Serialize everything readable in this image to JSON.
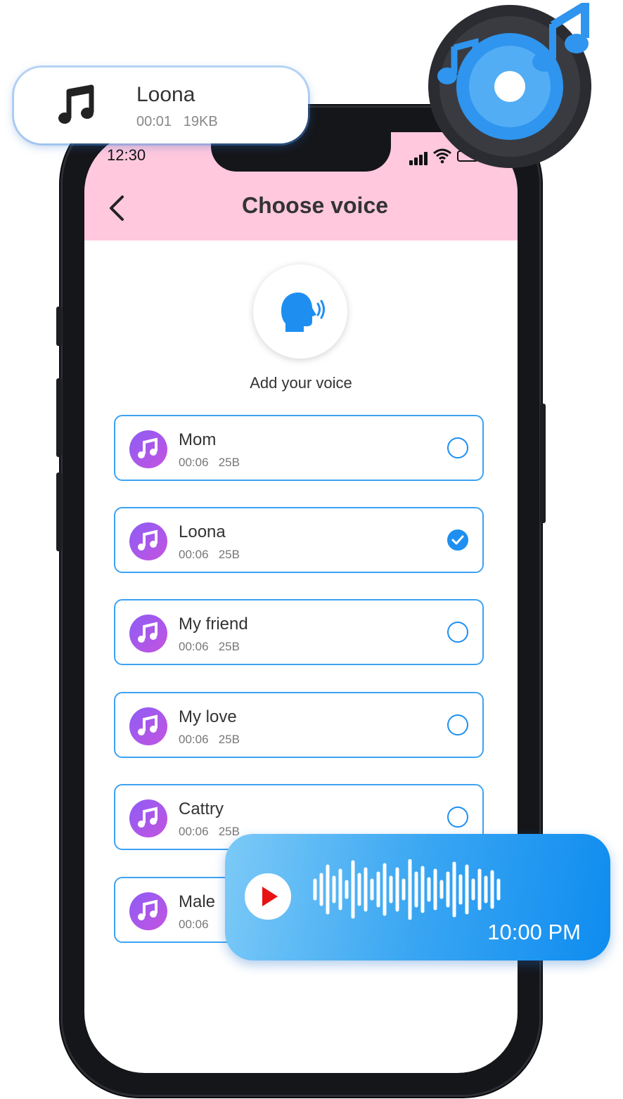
{
  "status_bar": {
    "time": "12:30"
  },
  "header": {
    "title": "Choose voice"
  },
  "add_voice": {
    "label": "Add your voice",
    "icon": "speaking-head-icon"
  },
  "voices": [
    {
      "name": "Mom",
      "duration": "00:06",
      "size": "25B",
      "selected": false
    },
    {
      "name": "Loona",
      "duration": "00:06",
      "size": "25B",
      "selected": true
    },
    {
      "name": "My friend",
      "duration": "00:06",
      "size": "25B",
      "selected": false
    },
    {
      "name": "My love",
      "duration": "00:06",
      "size": "25B",
      "selected": false
    },
    {
      "name": "Cattry",
      "duration": "00:06",
      "size": "25B",
      "selected": false
    },
    {
      "name": "Male",
      "duration": "00:06",
      "size": "",
      "selected": false
    }
  ],
  "floating_top_card": {
    "title": "Loona",
    "duration": "00:01",
    "size": "19KB"
  },
  "audio_message": {
    "time": "10:00 PM"
  },
  "colors": {
    "header_bg": "#ffc8dd",
    "accent_blue": "#1e8ff0",
    "item_border": "#3ea2f2",
    "music_avatar": "#a358e8",
    "play_red": "#e81212"
  }
}
